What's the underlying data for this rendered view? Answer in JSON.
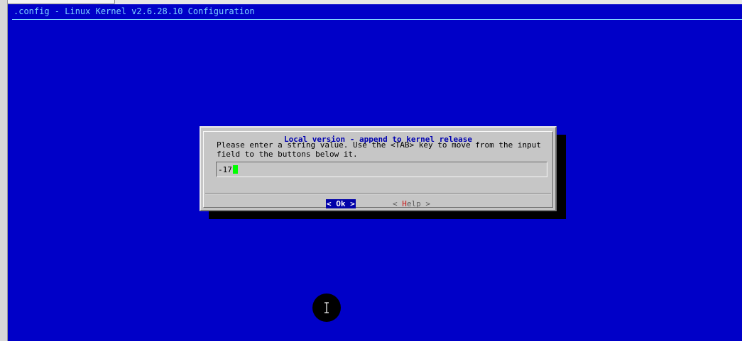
{
  "terminal": {
    "title": ".config - Linux Kernel v2.6.28.10 Configuration"
  },
  "dialog": {
    "title": "Local version - append to kernel release",
    "prompt_line1": "Please enter a string value. Use the <TAB> key to move from the input",
    "prompt_line2": "field to the buttons below it.",
    "input_value": "-17",
    "ok_button": {
      "open": "<",
      "label": "Ok",
      "close": ">"
    },
    "help_button": {
      "open": "<",
      "hotkey": "H",
      "rest": "elp",
      "close": ">"
    }
  },
  "colors": {
    "terminal_bg": "#0000c8",
    "dialog_bg": "#c6c6c6",
    "title_text": "#0000b0",
    "cursor": "#00ff00",
    "hotkey": "#c81818"
  },
  "icons": {
    "pointer": "text-cursor-icon"
  }
}
